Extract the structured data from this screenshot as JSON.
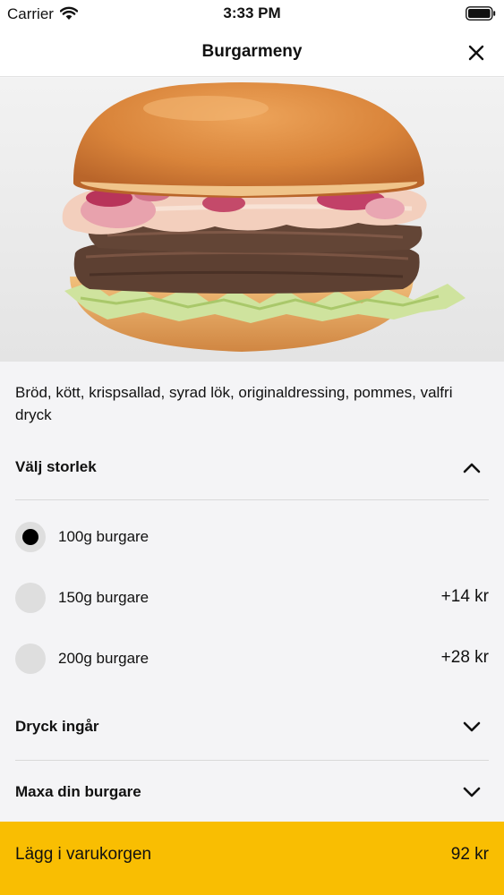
{
  "status_bar": {
    "carrier": "Carrier",
    "time": "3:33 PM"
  },
  "header": {
    "title": "Burgarmeny"
  },
  "product": {
    "description": "Bröd, kött, krispsallad, syrad lök, originaldressing, pommes, valfri dryck"
  },
  "size_section": {
    "title": "Välj storlek",
    "expanded": true,
    "options": [
      {
        "label": "100g burgare",
        "price": "",
        "selected": true
      },
      {
        "label": "150g burgare",
        "price": "+14 kr",
        "selected": false
      },
      {
        "label": "200g burgare",
        "price": "+28 kr",
        "selected": false
      }
    ]
  },
  "drink_section": {
    "title": "Dryck ingår",
    "expanded": false
  },
  "maxa_section": {
    "title": "Maxa din burgare",
    "expanded": false
  },
  "cart_button": {
    "label": "Lägg i varukorgen",
    "price": "92 kr"
  },
  "colors": {
    "accent": "#f9be02",
    "background": "#f4f4f6",
    "radio": "#dedede"
  }
}
